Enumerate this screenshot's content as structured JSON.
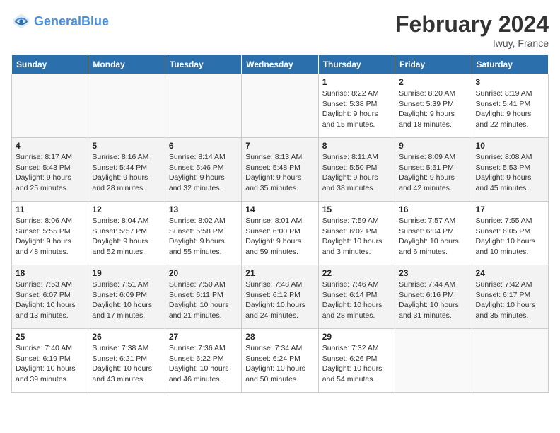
{
  "header": {
    "logo_text_general": "General",
    "logo_text_blue": "Blue",
    "month_title": "February 2024",
    "location": "Iwuy, France"
  },
  "days_of_week": [
    "Sunday",
    "Monday",
    "Tuesday",
    "Wednesday",
    "Thursday",
    "Friday",
    "Saturday"
  ],
  "weeks": [
    [
      {
        "day": "",
        "info": ""
      },
      {
        "day": "",
        "info": ""
      },
      {
        "day": "",
        "info": ""
      },
      {
        "day": "",
        "info": ""
      },
      {
        "day": "1",
        "info": "Sunrise: 8:22 AM\nSunset: 5:38 PM\nDaylight: 9 hours\nand 15 minutes."
      },
      {
        "day": "2",
        "info": "Sunrise: 8:20 AM\nSunset: 5:39 PM\nDaylight: 9 hours\nand 18 minutes."
      },
      {
        "day": "3",
        "info": "Sunrise: 8:19 AM\nSunset: 5:41 PM\nDaylight: 9 hours\nand 22 minutes."
      }
    ],
    [
      {
        "day": "4",
        "info": "Sunrise: 8:17 AM\nSunset: 5:43 PM\nDaylight: 9 hours\nand 25 minutes."
      },
      {
        "day": "5",
        "info": "Sunrise: 8:16 AM\nSunset: 5:44 PM\nDaylight: 9 hours\nand 28 minutes."
      },
      {
        "day": "6",
        "info": "Sunrise: 8:14 AM\nSunset: 5:46 PM\nDaylight: 9 hours\nand 32 minutes."
      },
      {
        "day": "7",
        "info": "Sunrise: 8:13 AM\nSunset: 5:48 PM\nDaylight: 9 hours\nand 35 minutes."
      },
      {
        "day": "8",
        "info": "Sunrise: 8:11 AM\nSunset: 5:50 PM\nDaylight: 9 hours\nand 38 minutes."
      },
      {
        "day": "9",
        "info": "Sunrise: 8:09 AM\nSunset: 5:51 PM\nDaylight: 9 hours\nand 42 minutes."
      },
      {
        "day": "10",
        "info": "Sunrise: 8:08 AM\nSunset: 5:53 PM\nDaylight: 9 hours\nand 45 minutes."
      }
    ],
    [
      {
        "day": "11",
        "info": "Sunrise: 8:06 AM\nSunset: 5:55 PM\nDaylight: 9 hours\nand 48 minutes."
      },
      {
        "day": "12",
        "info": "Sunrise: 8:04 AM\nSunset: 5:57 PM\nDaylight: 9 hours\nand 52 minutes."
      },
      {
        "day": "13",
        "info": "Sunrise: 8:02 AM\nSunset: 5:58 PM\nDaylight: 9 hours\nand 55 minutes."
      },
      {
        "day": "14",
        "info": "Sunrise: 8:01 AM\nSunset: 6:00 PM\nDaylight: 9 hours\nand 59 minutes."
      },
      {
        "day": "15",
        "info": "Sunrise: 7:59 AM\nSunset: 6:02 PM\nDaylight: 10 hours\nand 3 minutes."
      },
      {
        "day": "16",
        "info": "Sunrise: 7:57 AM\nSunset: 6:04 PM\nDaylight: 10 hours\nand 6 minutes."
      },
      {
        "day": "17",
        "info": "Sunrise: 7:55 AM\nSunset: 6:05 PM\nDaylight: 10 hours\nand 10 minutes."
      }
    ],
    [
      {
        "day": "18",
        "info": "Sunrise: 7:53 AM\nSunset: 6:07 PM\nDaylight: 10 hours\nand 13 minutes."
      },
      {
        "day": "19",
        "info": "Sunrise: 7:51 AM\nSunset: 6:09 PM\nDaylight: 10 hours\nand 17 minutes."
      },
      {
        "day": "20",
        "info": "Sunrise: 7:50 AM\nSunset: 6:11 PM\nDaylight: 10 hours\nand 21 minutes."
      },
      {
        "day": "21",
        "info": "Sunrise: 7:48 AM\nSunset: 6:12 PM\nDaylight: 10 hours\nand 24 minutes."
      },
      {
        "day": "22",
        "info": "Sunrise: 7:46 AM\nSunset: 6:14 PM\nDaylight: 10 hours\nand 28 minutes."
      },
      {
        "day": "23",
        "info": "Sunrise: 7:44 AM\nSunset: 6:16 PM\nDaylight: 10 hours\nand 31 minutes."
      },
      {
        "day": "24",
        "info": "Sunrise: 7:42 AM\nSunset: 6:17 PM\nDaylight: 10 hours\nand 35 minutes."
      }
    ],
    [
      {
        "day": "25",
        "info": "Sunrise: 7:40 AM\nSunset: 6:19 PM\nDaylight: 10 hours\nand 39 minutes."
      },
      {
        "day": "26",
        "info": "Sunrise: 7:38 AM\nSunset: 6:21 PM\nDaylight: 10 hours\nand 43 minutes."
      },
      {
        "day": "27",
        "info": "Sunrise: 7:36 AM\nSunset: 6:22 PM\nDaylight: 10 hours\nand 46 minutes."
      },
      {
        "day": "28",
        "info": "Sunrise: 7:34 AM\nSunset: 6:24 PM\nDaylight: 10 hours\nand 50 minutes."
      },
      {
        "day": "29",
        "info": "Sunrise: 7:32 AM\nSunset: 6:26 PM\nDaylight: 10 hours\nand 54 minutes."
      },
      {
        "day": "",
        "info": ""
      },
      {
        "day": "",
        "info": ""
      }
    ]
  ]
}
